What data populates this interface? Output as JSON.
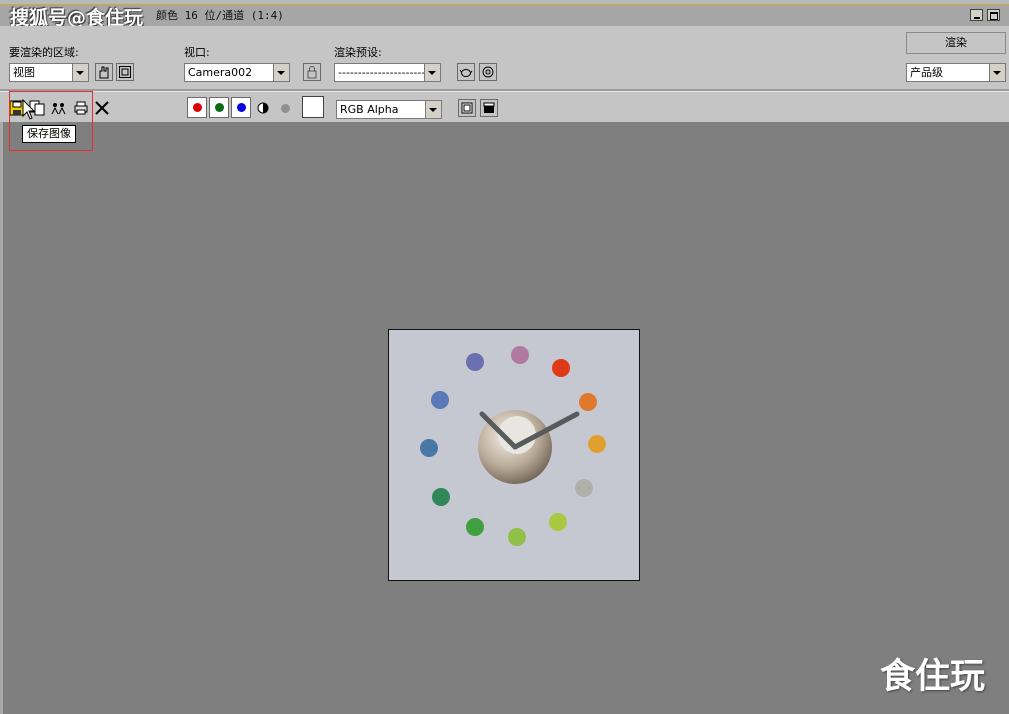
{
  "titlebar": {
    "title": "颜色 16 位/通道 (1:4)",
    "watermark": "搜狐号@食住玩"
  },
  "render_settings": {
    "area_label": "要渲染的区域:",
    "area_value": "视图",
    "viewport_label": "视口:",
    "viewport_value": "Camera002",
    "preset_label": "渲染预设:",
    "preset_value": "----------------------",
    "render_button": "渲染",
    "quality_value": "产品级"
  },
  "toolbar": {
    "channel_value": "RGB Alpha",
    "channel_colors": {
      "red": "#e00000",
      "green": "#0a6a14",
      "blue": "#0000e0"
    },
    "tooltip": "保存图像"
  },
  "watermark_bottom": "食住玩"
}
